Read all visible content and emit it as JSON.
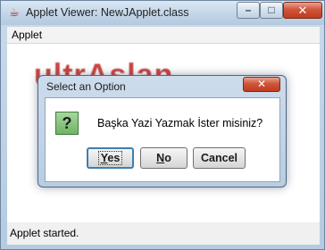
{
  "window": {
    "title": "Applet Viewer: NewJApplet.class",
    "controls": {
      "minimize": "–",
      "maximize": "□",
      "close": "✕"
    }
  },
  "menubar": {
    "items": [
      "Applet"
    ]
  },
  "applet": {
    "background_text": "ultrAslan"
  },
  "status": {
    "text": "Applet started."
  },
  "dialog": {
    "title": "Select an Option",
    "close": "✕",
    "icon": "question-icon",
    "icon_glyph": "?",
    "message": "Başka Yazi Yazmak İster misiniz?",
    "buttons": [
      {
        "first": "Y",
        "rest": "es"
      },
      {
        "first": "N",
        "rest": "o"
      },
      {
        "label": "Cancel"
      }
    ]
  }
}
